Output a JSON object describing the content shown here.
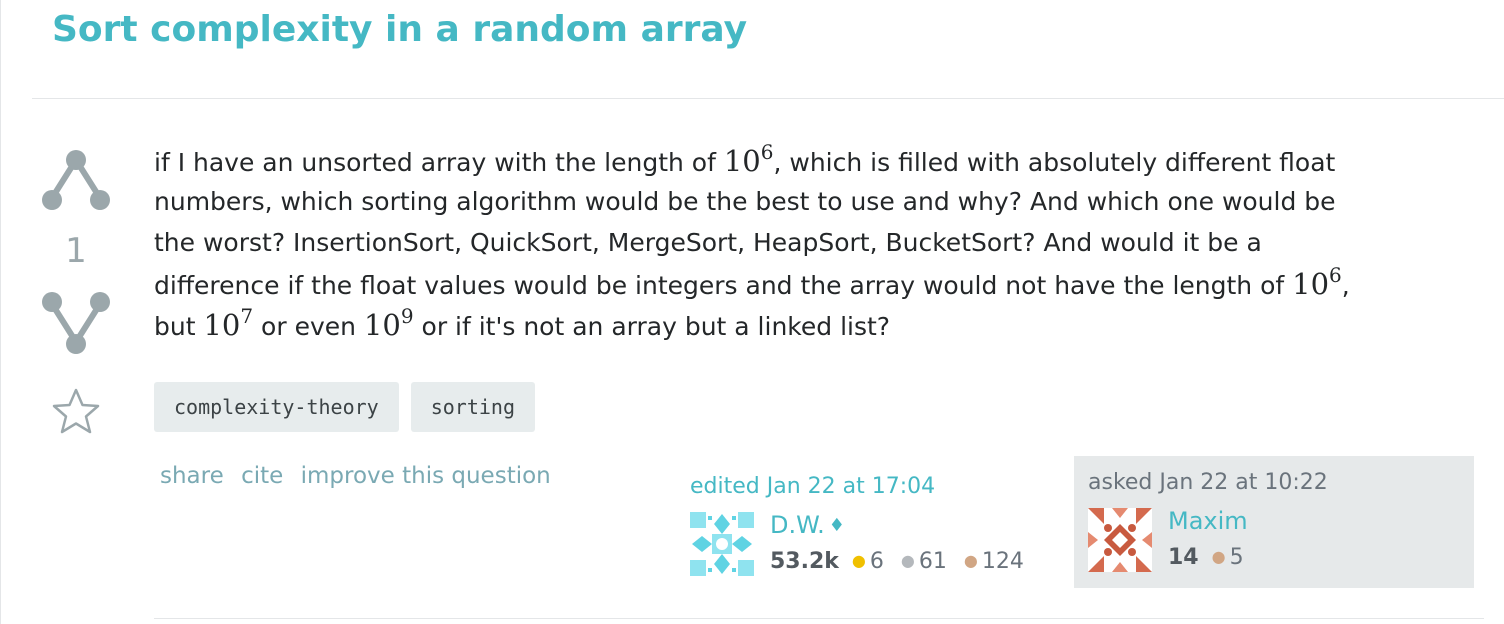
{
  "question": {
    "title": "Sort complexity in a random array",
    "vote_count": "1",
    "body": {
      "line1_pre": "if I have an unsorted array with the length of ",
      "line1_math_base": "10",
      "line1_math_exp": "6",
      "line1_post": ", which is filled with absolutely different float",
      "line2": "numbers, which sorting algorithm would be the best to use and why? And which one would be",
      "line3": "the worst? InsertionSort, QuickSort, MergeSort, HeapSort, BucketSort? And would it be a",
      "line4_pre": "difference if the float values would be integers and the array would not have the length of ",
      "line4_math_base": "10",
      "line4_math_exp": "6",
      "line4_post": ",",
      "line5_pre": "but ",
      "line5_math1_base": "10",
      "line5_math1_exp": "7",
      "line5_mid": " or even ",
      "line5_math2_base": "10",
      "line5_math2_exp": "9",
      "line5_post": " or if it's not an array but a linked list?"
    },
    "tags": [
      "complexity-theory",
      "sorting"
    ],
    "menu": {
      "share": "share",
      "cite": "cite",
      "improve": "improve this question"
    }
  },
  "edited": {
    "action": "edited Jan 22 at 17:04",
    "user_name": "D.W.",
    "mod_diamond": "♦",
    "reputation": "53.2k",
    "gold_badges": "6",
    "silver_badges": "61",
    "bronze_badges": "124"
  },
  "asked": {
    "action": "asked Jan 22 at 10:22",
    "user_name": "Maxim",
    "reputation": "14",
    "bronze_badges": "5"
  },
  "colors": {
    "accent": "#45b8c4",
    "link_muted": "#7aa9b3",
    "vote_gray": "#9ba7ab",
    "tag_bg": "#e7eced",
    "card_bg": "#e6e9ea"
  },
  "icons": {
    "upvote": "upvote-arrow-icon",
    "downvote": "downvote-arrow-icon",
    "favorite": "star-icon",
    "mod": "diamond-icon",
    "gold": "gold-badge-icon",
    "silver": "silver-badge-icon",
    "bronze": "bronze-badge-icon"
  }
}
